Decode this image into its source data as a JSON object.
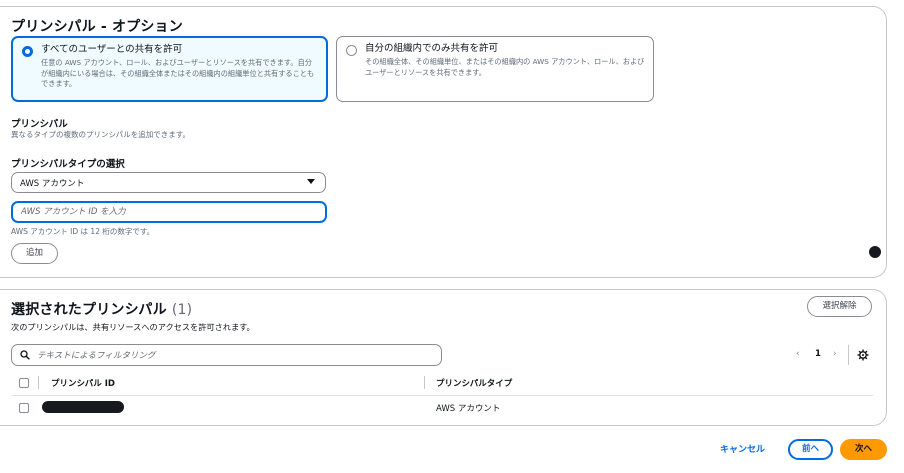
{
  "options_panel": {
    "title": "プリンシパル - オプション",
    "tiles": [
      {
        "title": "すべてのユーザーとの共有を許可",
        "description": "任意の AWS アカウント、ロール、およびユーザーとリソースを共有できます。自分が組織内にいる場合は、その組織全体またはその組織内の組織単位と共有することもできます。",
        "selected": true
      },
      {
        "title": "自分の組織内でのみ共有を許可",
        "description": "その組織全体、その組織単位、またはその組織内の AWS アカウント、ロール、およびユーザーとリソースを共有できます。",
        "selected": false
      }
    ],
    "principal_label": "プリンシパル",
    "principal_description": "異なるタイプの複数のプリンシパルを追加できます。",
    "type_select_label": "プリンシパルタイプの選択",
    "type_select_value": "AWS アカウント",
    "account_input_placeholder": "AWS アカウント ID を入力",
    "account_input_hint": "AWS アカウント ID は 12 桁の数字です。",
    "add_button": "追加"
  },
  "selected_panel": {
    "title": "選択されたプリンシパル",
    "count": "(1)",
    "description": "次のプリンシパルは、共有リソースへのアクセスを許可されます。",
    "clear_button": "選択解除",
    "filter_placeholder": "テキストによるフィルタリング",
    "page_number": "1",
    "columns": [
      "プリンシパル ID",
      "プリンシパルタイプ"
    ],
    "rows": [
      {
        "principal_id": "",
        "principal_type": "AWS アカウント"
      }
    ]
  },
  "footer": {
    "cancel": "キャンセル",
    "previous": "前へ",
    "next": "次へ"
  },
  "colors": {
    "accent": "#006ce0",
    "primary_button": "#ff9900"
  }
}
